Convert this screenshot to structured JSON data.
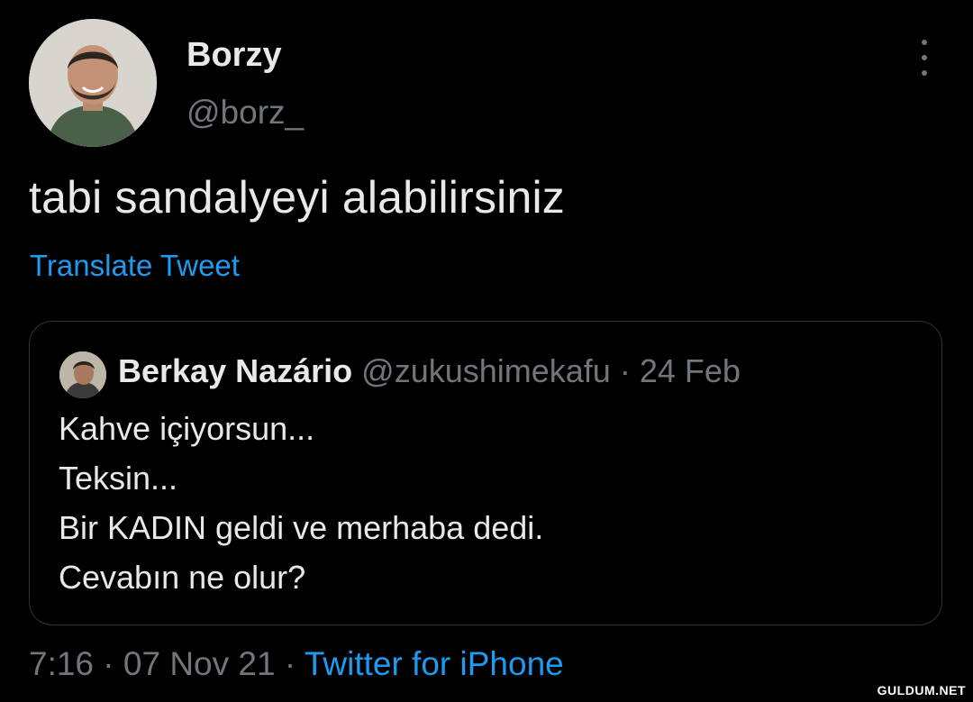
{
  "tweet": {
    "author_name": "Borzy",
    "author_handle": "@borz_",
    "more_icon": "more-vertical-icon",
    "text": "tabi sandalyeyi alabilirsiniz",
    "translate_label": "Translate Tweet",
    "time": "7:16",
    "separator": "·",
    "date": "07 Nov 21",
    "source": "Twitter for iPhone"
  },
  "quoted": {
    "author_name": "Berkay Nazário",
    "author_handle": "@zukushimekafu",
    "separator": "·",
    "date": "24 Feb",
    "lines": [
      "Kahve içiyorsun...",
      "Teksin...",
      "Bir KADIN geldi ve merhaba dedi.",
      "Cevabın ne olur?"
    ]
  },
  "watermark": {
    "text": "GULDUM.NET"
  },
  "colors": {
    "background": "#000000",
    "text": "#e7e9ea",
    "muted": "#71767b",
    "link": "#1d9bf0",
    "border": "#2f3336"
  }
}
